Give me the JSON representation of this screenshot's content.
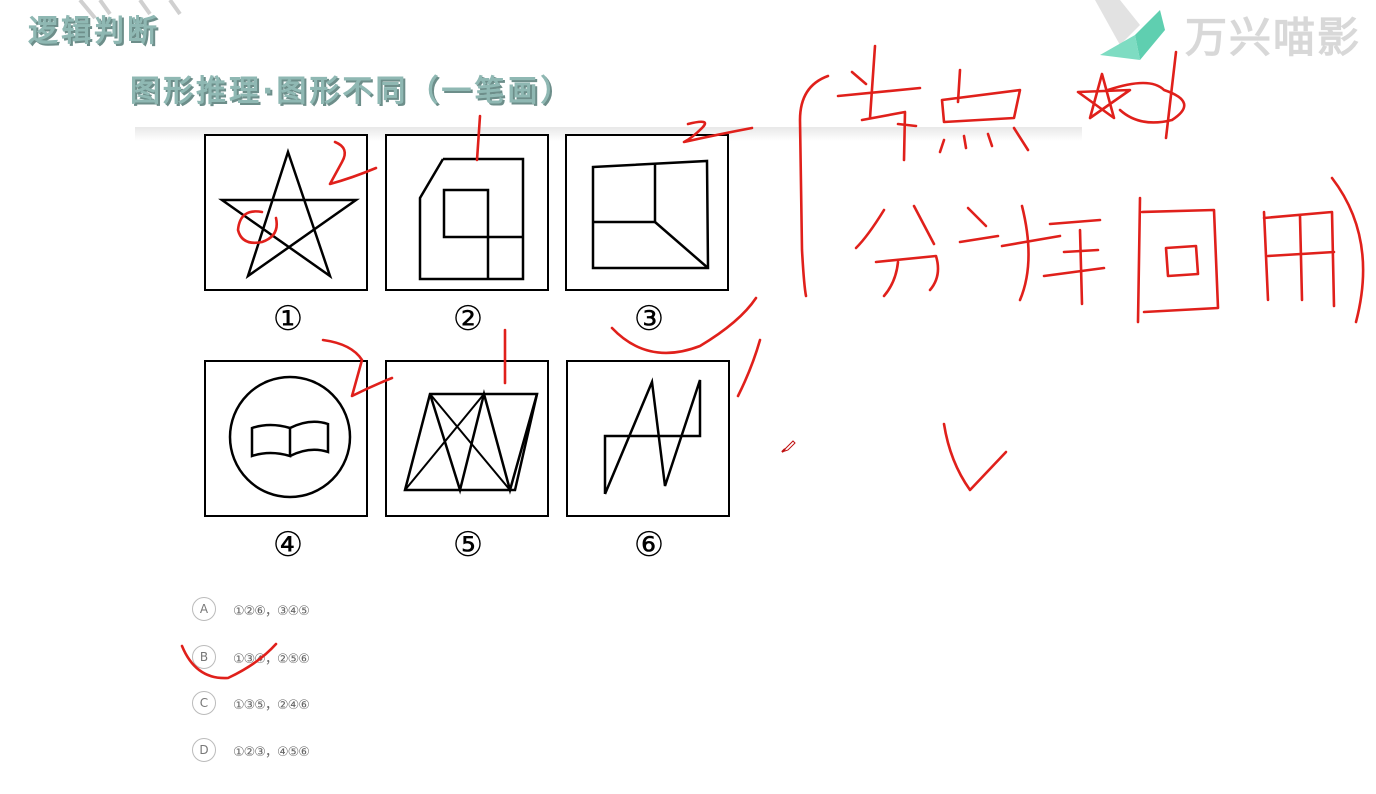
{
  "header": {
    "section_title": "逻辑判断",
    "subtitle": "图形推理·图形不同（一笔画）",
    "watermark": "万兴喵影"
  },
  "figures": [
    {
      "number": "①"
    },
    {
      "number": "②"
    },
    {
      "number": "③"
    },
    {
      "number": "④"
    },
    {
      "number": "⑤"
    },
    {
      "number": "⑥"
    }
  ],
  "options": [
    {
      "letter": "A",
      "text": "①②⑥，③④⑤"
    },
    {
      "letter": "B",
      "text": "①③④，②⑤⑥"
    },
    {
      "letter": "C",
      "text": "①③⑤，②④⑥"
    },
    {
      "letter": "D",
      "text": "①②③，④⑤⑥"
    }
  ],
  "colors": {
    "title_teal": "#8fb8b3",
    "annotation_red": "#e0201b",
    "logo_green": "#5fcfb0"
  }
}
